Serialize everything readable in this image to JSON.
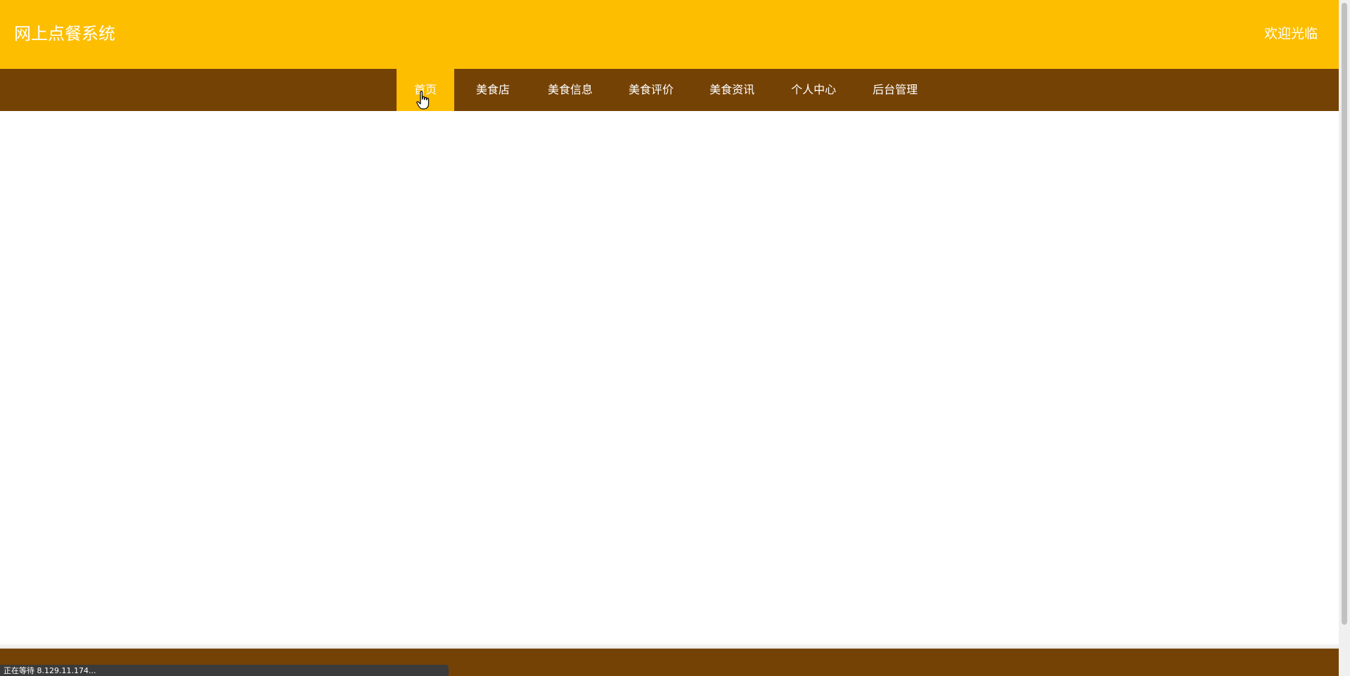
{
  "header": {
    "site_title": "网上点餐系统",
    "welcome_text": "欢迎光临"
  },
  "nav": {
    "active_index": 0,
    "items": [
      {
        "label": "首页"
      },
      {
        "label": "美食店"
      },
      {
        "label": "美食信息"
      },
      {
        "label": "美食评价"
      },
      {
        "label": "美食资讯"
      },
      {
        "label": "个人中心"
      },
      {
        "label": "后台管理"
      }
    ]
  },
  "browser_status": {
    "text": "正在等待 8.129.11.174..."
  },
  "colors": {
    "header_bg": "#fdbe00",
    "nav_bg": "#754205",
    "active_tab_bg": "#fdbe00",
    "footer_bg": "#754205",
    "text": "#ffffff"
  }
}
